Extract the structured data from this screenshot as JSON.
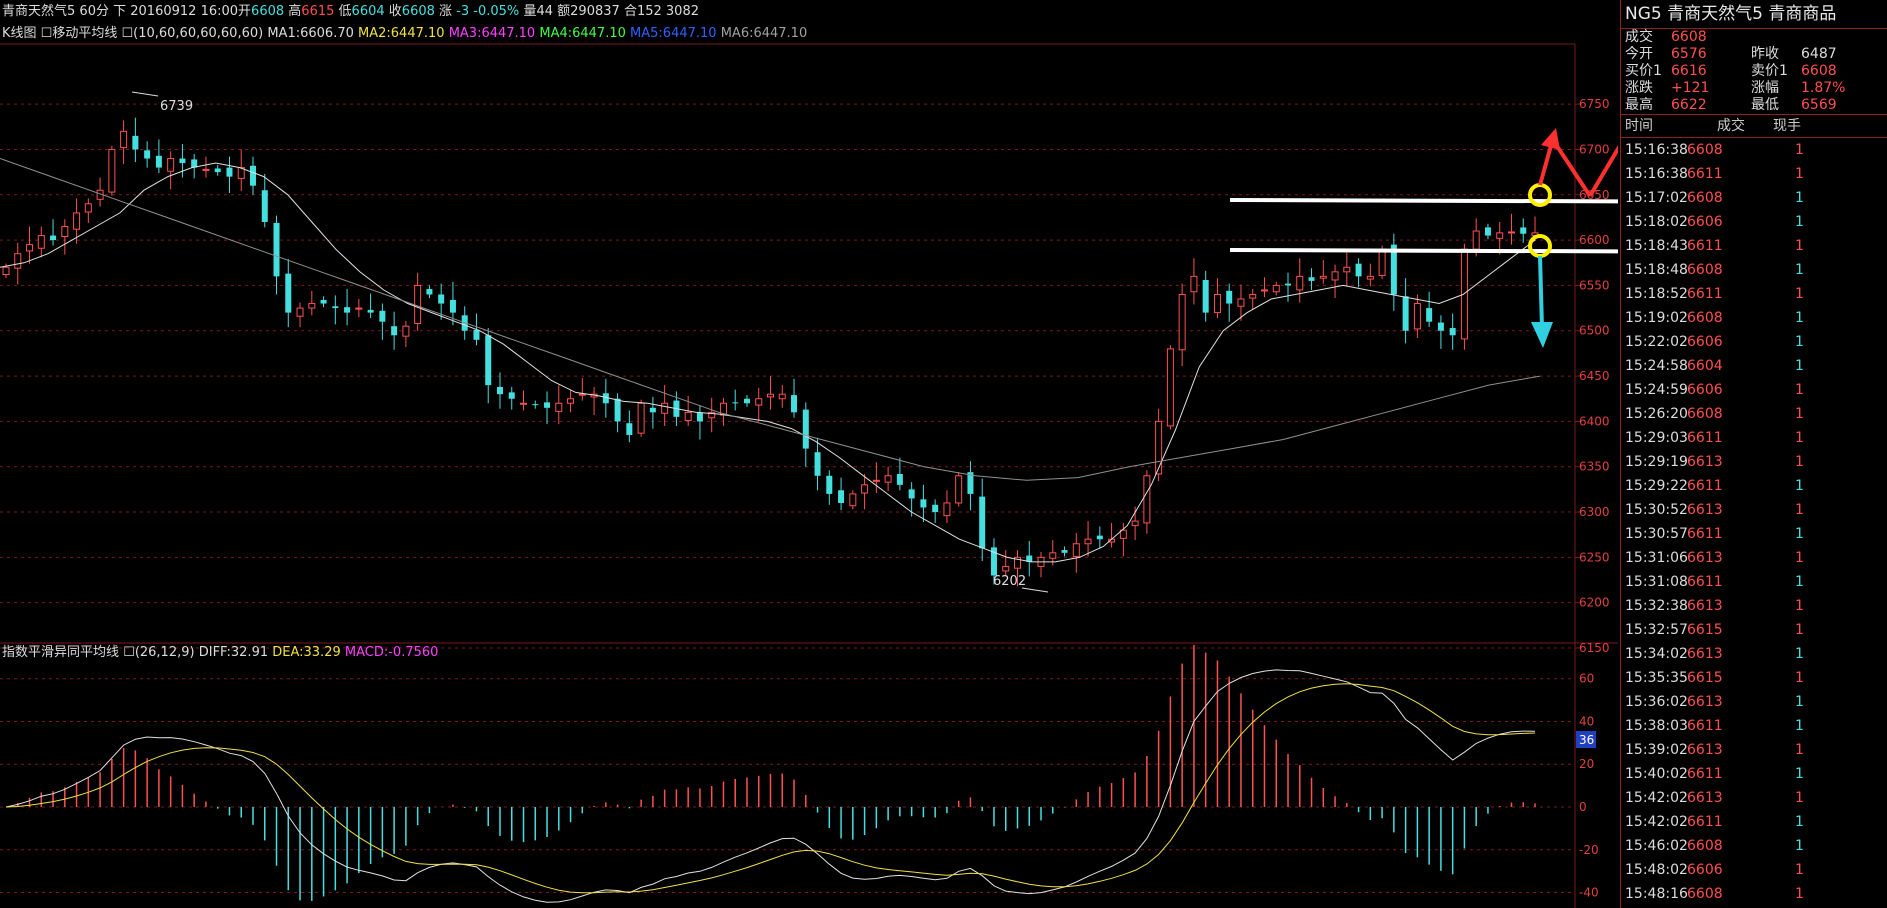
{
  "header": {
    "title": "青商天然气5",
    "period": "60分",
    "direction": "下",
    "datetime": "20160912 16:00",
    "open_label": "开",
    "open": "6608",
    "high_label": "高",
    "high": "6615",
    "low_label": "低",
    "low": "6604",
    "close_label": "收",
    "close": "6608",
    "change_label": "涨",
    "change": "-3",
    "change_pct": "-0.05%",
    "volume_label": "量",
    "volume": "44",
    "amount_label": "额",
    "amount": "290837",
    "position_label": "合",
    "position": "152 3082"
  },
  "ma_bar": {
    "name": "K线图",
    "indicator": "移动平均线",
    "params": "(10,60,60,60,60,60)",
    "ma1": "MA1:6606.70",
    "ma2": "MA2:6447.10",
    "ma3": "MA3:6447.10",
    "ma4": "MA4:6447.10",
    "ma5": "MA5:6447.10",
    "ma6": "MA6:6447.10"
  },
  "macd_bar": {
    "name": "指数平滑异同平均线",
    "params": "(26,12,9)",
    "diff": "DIFF:32.91",
    "dea": "DEA:33.29",
    "macd": "MACD:-0.7560"
  },
  "price_axis": [
    "6750",
    "6700",
    "6650",
    "6600",
    "6550",
    "6500",
    "6450",
    "6400",
    "6350",
    "6300",
    "6250",
    "6200",
    "6150"
  ],
  "macd_axis": [
    "60",
    "40",
    "20",
    "0",
    "-20",
    "-40"
  ],
  "macd_current": "36",
  "annotations": {
    "high_label": "6739",
    "low_label": "6202"
  },
  "quote_panel": {
    "title": "NG5  青商天然气5   青商商品",
    "rows": [
      {
        "l1": "成交",
        "v1": "6608",
        "l2": "",
        "v2": ""
      },
      {
        "l1": "今开",
        "v1": "6576",
        "l2": "昨收",
        "v2": "6487"
      },
      {
        "l1": "买价1",
        "v1": "6616",
        "l2": "卖价1",
        "v2": "6608"
      },
      {
        "l1": "涨跌",
        "v1": "+121",
        "l2": "涨幅",
        "v2": "1.87%"
      },
      {
        "l1": "最高",
        "v1": "6622",
        "l2": "最低",
        "v2": "6569"
      }
    ],
    "ticks_header": {
      "time": "时间",
      "price": "成交",
      "qty": "现手"
    },
    "ticks": [
      {
        "time": "15:16:38",
        "price": "6608",
        "qty": "1",
        "c": "red"
      },
      {
        "time": "15:16:38",
        "price": "6611",
        "qty": "1",
        "c": "red"
      },
      {
        "time": "15:17:02",
        "price": "6608",
        "qty": "1",
        "c": "cyan"
      },
      {
        "time": "15:18:02",
        "price": "6606",
        "qty": "1",
        "c": "cyan"
      },
      {
        "time": "15:18:43",
        "price": "6611",
        "qty": "1",
        "c": "red"
      },
      {
        "time": "15:18:48",
        "price": "6608",
        "qty": "1",
        "c": "cyan"
      },
      {
        "time": "15:18:52",
        "price": "6611",
        "qty": "1",
        "c": "red"
      },
      {
        "time": "15:19:02",
        "price": "6608",
        "qty": "1",
        "c": "cyan"
      },
      {
        "time": "15:22:02",
        "price": "6606",
        "qty": "1",
        "c": "cyan"
      },
      {
        "time": "15:24:58",
        "price": "6604",
        "qty": "1",
        "c": "cyan"
      },
      {
        "time": "15:24:59",
        "price": "6606",
        "qty": "1",
        "c": "red"
      },
      {
        "time": "15:26:20",
        "price": "6608",
        "qty": "1",
        "c": "red"
      },
      {
        "time": "15:29:03",
        "price": "6611",
        "qty": "1",
        "c": "red"
      },
      {
        "time": "15:29:19",
        "price": "6613",
        "qty": "1",
        "c": "red"
      },
      {
        "time": "15:29:22",
        "price": "6611",
        "qty": "1",
        "c": "cyan"
      },
      {
        "time": "15:30:52",
        "price": "6613",
        "qty": "1",
        "c": "red"
      },
      {
        "time": "15:30:57",
        "price": "6611",
        "qty": "1",
        "c": "cyan"
      },
      {
        "time": "15:31:06",
        "price": "6613",
        "qty": "1",
        "c": "red"
      },
      {
        "time": "15:31:08",
        "price": "6611",
        "qty": "1",
        "c": "cyan"
      },
      {
        "time": "15:32:38",
        "price": "6613",
        "qty": "1",
        "c": "red"
      },
      {
        "time": "15:32:57",
        "price": "6615",
        "qty": "1",
        "c": "red"
      },
      {
        "time": "15:34:02",
        "price": "6613",
        "qty": "1",
        "c": "cyan"
      },
      {
        "time": "15:35:35",
        "price": "6615",
        "qty": "1",
        "c": "red"
      },
      {
        "time": "15:36:02",
        "price": "6613",
        "qty": "1",
        "c": "cyan"
      },
      {
        "time": "15:38:03",
        "price": "6611",
        "qty": "1",
        "c": "cyan"
      },
      {
        "time": "15:39:02",
        "price": "6613",
        "qty": "1",
        "c": "red"
      },
      {
        "time": "15:40:02",
        "price": "6611",
        "qty": "1",
        "c": "cyan"
      },
      {
        "time": "15:42:02",
        "price": "6613",
        "qty": "1",
        "c": "red"
      },
      {
        "time": "15:42:02",
        "price": "6611",
        "qty": "1",
        "c": "cyan"
      },
      {
        "time": "15:46:02",
        "price": "6608",
        "qty": "1",
        "c": "cyan"
      },
      {
        "time": "15:48:02",
        "price": "6606",
        "qty": "1",
        "c": "red"
      },
      {
        "time": "15:48:16",
        "price": "6608",
        "qty": "1",
        "c": "red"
      }
    ]
  },
  "colors": {
    "up": "#ff5050",
    "down": "#44e0e0",
    "grid": "#7a1a1a",
    "ma_short": "#e0e0e0",
    "ma_long": "#909090",
    "dea": "#f0e040",
    "arrow_red": "#ff3030",
    "arrow_white": "#ffffff",
    "arrow_cyan": "#30d0e0",
    "marker": "#ffee00"
  },
  "chart_data": {
    "type": "candlestick",
    "ylim": [
      6150,
      6770
    ],
    "extremes": {
      "high": 6739,
      "low": 6202
    },
    "closes": [
      6570,
      6585,
      6595,
      6605,
      6600,
      6615,
      6630,
      6640,
      6655,
      6700,
      6720,
      6700,
      6690,
      6680,
      6690,
      6685,
      6680,
      6678,
      6675,
      6670,
      6680,
      6660,
      6620,
      6560,
      6520,
      6525,
      6530,
      6530,
      6525,
      6520,
      6525,
      6520,
      6510,
      6495,
      6505,
      6550,
      6540,
      6530,
      6520,
      6500,
      6490,
      6440,
      6430,
      6425,
      6420,
      6418,
      6415,
      6420,
      6425,
      6430,
      6430,
      6420,
      6400,
      6385,
      6420,
      6410,
      6420,
      6405,
      6410,
      6400,
      6410,
      6420,
      6420,
      6420,
      6425,
      6430,
      6430,
      6410,
      6370,
      6340,
      6320,
      6310,
      6320,
      6330,
      6335,
      6340,
      6330,
      6315,
      6305,
      6300,
      6310,
      6340,
      6320,
      6260,
      6230,
      6240,
      6250,
      6245,
      6250,
      6255,
      6255,
      6265,
      6270,
      6270,
      6270,
      6280,
      6290,
      6340,
      6400,
      6480,
      6540,
      6560,
      6520,
      6540,
      6530,
      6535,
      6540,
      6545,
      6550,
      6550,
      6560,
      6555,
      6560,
      6565,
      6570,
      6560,
      6560,
      6590,
      6540,
      6500,
      6530,
      6510,
      6500,
      6495,
      6590,
      6610,
      6605,
      6608,
      6609,
      6607,
      6608
    ],
    "ma_short": [
      6570,
      6575,
      6585,
      6600,
      6615,
      6630,
      6655,
      6670,
      6680,
      6685,
      6680,
      6670,
      6650,
      6620,
      6590,
      6565,
      6545,
      6530,
      6520,
      6510,
      6500,
      6485,
      6465,
      6445,
      6432,
      6428,
      6422,
      6420,
      6415,
      6410,
      6408,
      6404,
      6400,
      6392,
      6378,
      6360,
      6340,
      6320,
      6300,
      6285,
      6270,
      6260,
      6250,
      6245,
      6245,
      6250,
      6262,
      6285,
      6330,
      6390,
      6460,
      6500,
      6520,
      6535,
      6540,
      6545,
      6550,
      6545,
      6540,
      6535,
      6530,
      6540,
      6560,
      6580,
      6600
    ],
    "ma_long": [
      6690,
      6670,
      6650,
      6630,
      6610,
      6590,
      6570,
      6550,
      6530,
      6510,
      6490,
      6470,
      6450,
      6430,
      6410,
      6395,
      6380,
      6365,
      6350,
      6340,
      6335,
      6338,
      6350,
      6360,
      6370,
      6380,
      6395,
      6410,
      6425,
      6440,
      6450
    ]
  }
}
